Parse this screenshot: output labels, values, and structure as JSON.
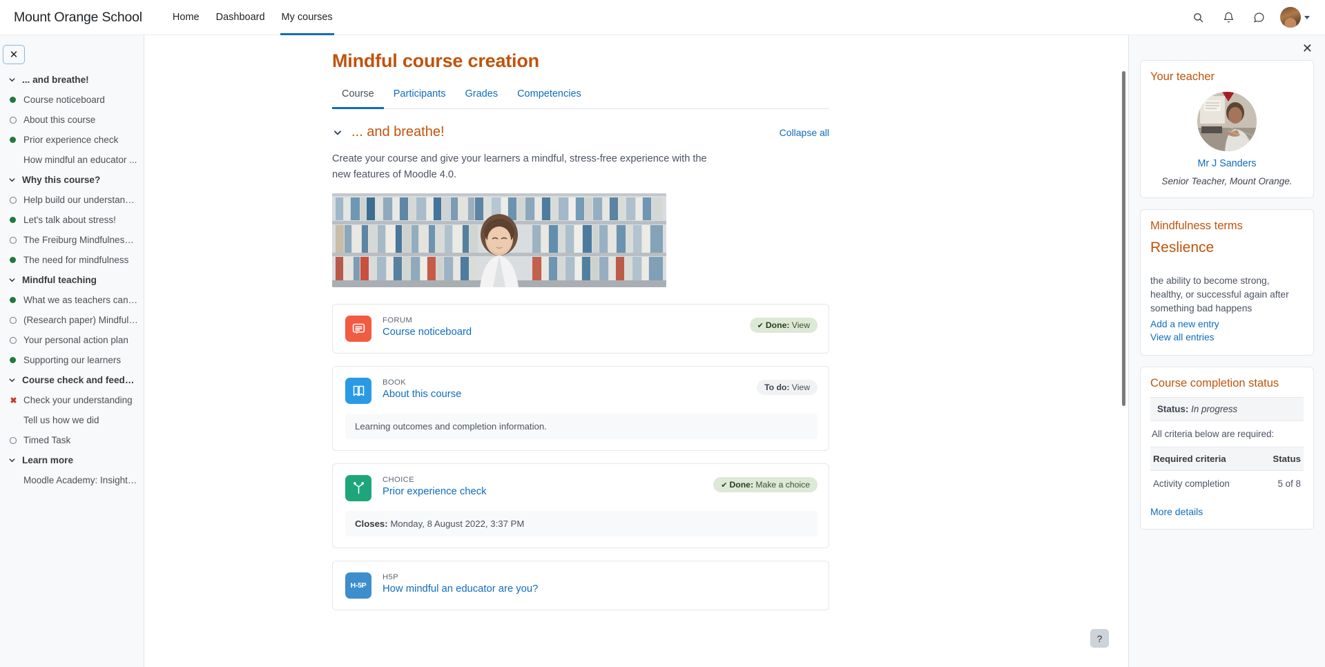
{
  "navbar": {
    "brand": "Mount Orange School",
    "links": [
      {
        "label": "Home",
        "active": false
      },
      {
        "label": "Dashboard",
        "active": false
      },
      {
        "label": "My courses",
        "active": true
      }
    ],
    "icons": {
      "search": "search-icon",
      "notifications": "bell-icon",
      "messages": "message-icon",
      "avatar": "user-avatar"
    }
  },
  "course_index": {
    "close_label": "✕",
    "sections": [
      {
        "label": "... and breathe!",
        "items": [
          {
            "label": "Course noticeboard",
            "state": "done"
          },
          {
            "label": "About this course",
            "state": "todo"
          },
          {
            "label": "Prior experience check",
            "state": "done"
          },
          {
            "label": "How mindful an educator ...",
            "state": "none"
          }
        ]
      },
      {
        "label": "Why this course?",
        "items": [
          {
            "label": "Help build our understandi...",
            "state": "todo"
          },
          {
            "label": "Let's talk about stress!",
            "state": "done"
          },
          {
            "label": "The Freiburg Mindfulness i...",
            "state": "todo"
          },
          {
            "label": "The need for mindfulness",
            "state": "done"
          }
        ]
      },
      {
        "label": "Mindful teaching",
        "items": [
          {
            "label": "What we as teachers can do",
            "state": "done"
          },
          {
            "label": "(Research paper) Mindfuln...",
            "state": "todo"
          },
          {
            "label": "Your personal action plan",
            "state": "todo"
          },
          {
            "label": "Supporting our learners",
            "state": "done"
          }
        ]
      },
      {
        "label": "Course check and feedb...",
        "items": [
          {
            "label": "Check your understanding",
            "state": "fail"
          },
          {
            "label": "Tell us how we did",
            "state": "none"
          },
          {
            "label": "Timed Task",
            "state": "todo"
          }
        ]
      },
      {
        "label": "Learn more",
        "items": [
          {
            "label": "Moodle Academy: Insight i...",
            "state": "none"
          }
        ]
      }
    ]
  },
  "main": {
    "title": "Mindful course creation",
    "tabs": [
      {
        "label": "Course",
        "active": true
      },
      {
        "label": "Participants",
        "active": false
      },
      {
        "label": "Grades",
        "active": false
      },
      {
        "label": "Competencies",
        "active": false
      }
    ],
    "section": {
      "title": "... and breathe!",
      "collapse_all": "Collapse all",
      "description": "Create your course and give your learners a mindful, stress-free experience with the new features of Moodle 4.0."
    },
    "activities": [
      {
        "type": "FORUM",
        "name": "Course noticeboard",
        "icon": "forum-icon",
        "icon_color": "#f15b42",
        "badge": {
          "state": "done",
          "prefix": "Done:",
          "action": "View"
        },
        "sub": null
      },
      {
        "type": "BOOK",
        "name": "About this course",
        "icon": "book-icon",
        "icon_color": "#2a9ae5",
        "badge": {
          "state": "todo",
          "prefix": "To do:",
          "action": "View"
        },
        "sub": "Learning outcomes and completion information."
      },
      {
        "type": "CHOICE",
        "name": "Prior experience check",
        "icon": "choice-icon",
        "icon_color": "#1ea67a",
        "badge": {
          "state": "done",
          "prefix": "Done:",
          "action": "Make a choice"
        },
        "sub_label": "Closes:",
        "sub": "Monday, 8 August 2022, 3:37 PM"
      },
      {
        "type": "H5P",
        "name": "How mindful an educator are you?",
        "icon": "h5p-icon",
        "icon_color": "#3d8ecb",
        "badge": null,
        "sub": null
      }
    ],
    "help_button": "?"
  },
  "drawer": {
    "close_label": "✕",
    "teacher_block": {
      "title": "Your teacher",
      "name": "Mr J Sanders",
      "role": "Senior Teacher, Mount Orange."
    },
    "glossary_block": {
      "title": "Mindfulness terms",
      "term": "Reslience",
      "definition": "the ability to become strong, healthy, or successful again after something bad happens",
      "add_link": "Add a new entry",
      "view_link": "View all entries"
    },
    "completion_block": {
      "title": "Course completion status",
      "status_label": "Status:",
      "status_value": "In progress",
      "criteria_note": "All criteria below are required:",
      "table_headers": [
        "Required criteria",
        "Status"
      ],
      "rows": [
        {
          "criteria": "Activity completion",
          "status": "5 of 8"
        }
      ],
      "more_details": "More details"
    }
  },
  "colors": {
    "brand_orange": "#c0530c",
    "link_blue": "#0f6cbf",
    "done_green": "#1f7a3d",
    "fail_red": "#c0392b"
  }
}
